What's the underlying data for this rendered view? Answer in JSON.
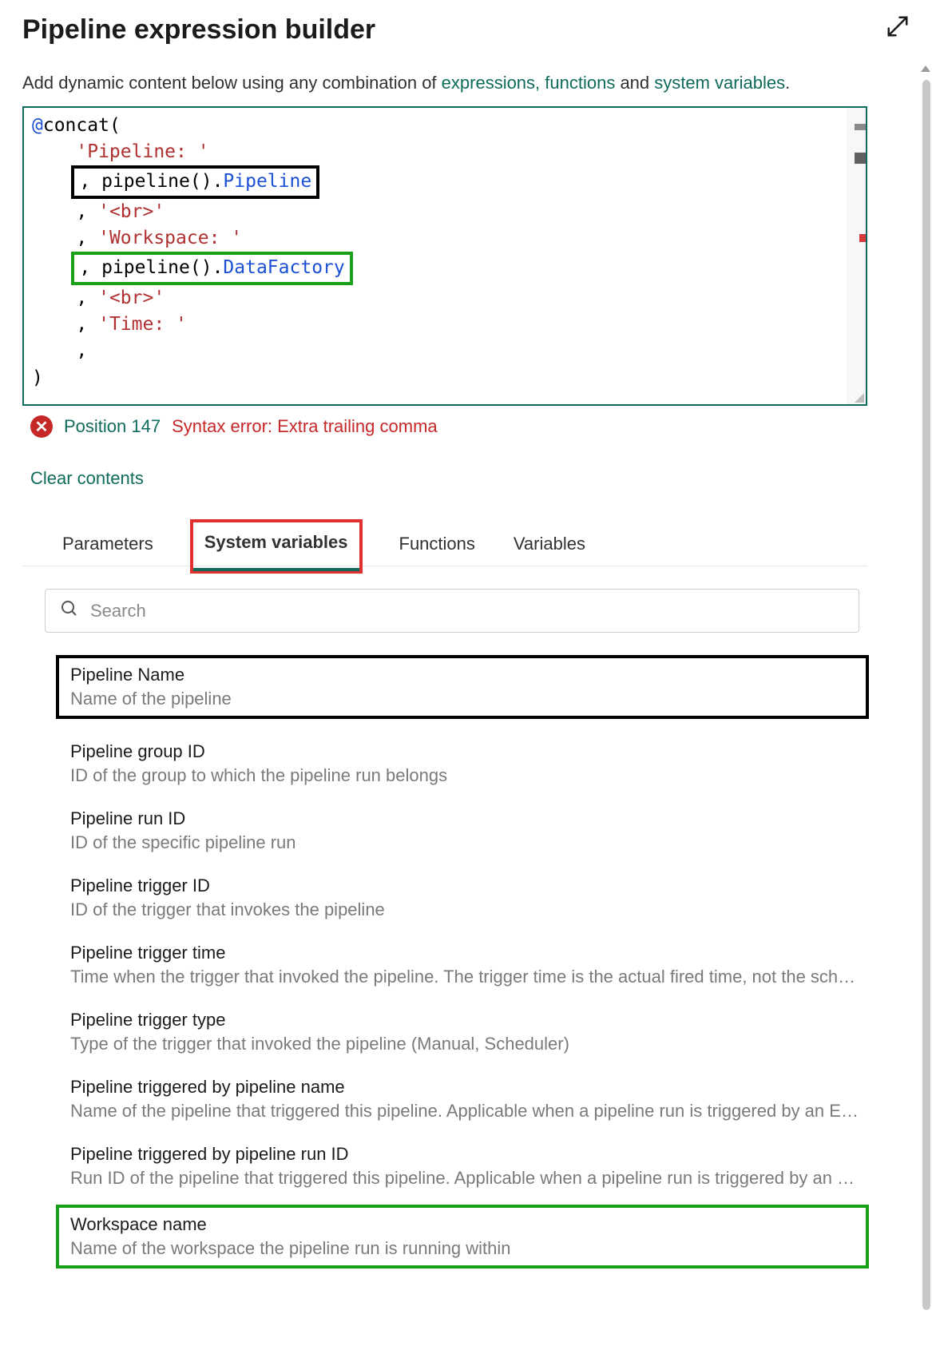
{
  "header": {
    "title": "Pipeline expression builder"
  },
  "intro": {
    "prefix": "Add dynamic content below using any combination of ",
    "link_expr_fn": "expressions, functions",
    "middle": " and ",
    "link_sysvars": "system variables",
    "suffix": "."
  },
  "editor": {
    "line1_at": "@",
    "line1_fn": "concat(",
    "line2_str": "'Pipeline: '",
    "line3_comma": ", ",
    "line3_call": "pipeline().",
    "line3_prop": "Pipeline",
    "line4_comma": ", ",
    "line4_str": "'<br>'",
    "line5_comma": ", ",
    "line5_str": "'Workspace: '",
    "line6_comma": ", ",
    "line6_call": "pipeline().",
    "line6_prop": "DataFactory",
    "line7_comma": ", ",
    "line7_str": "'<br>'",
    "line8_comma": ", ",
    "line8_str": "'Time: '",
    "line9_comma": ",",
    "line10_close": ")"
  },
  "error": {
    "position": "Position 147",
    "message": "Syntax error: Extra trailing comma"
  },
  "clear_contents": "Clear contents",
  "tabs": {
    "parameters": "Parameters",
    "system_variables": "System variables",
    "functions": "Functions",
    "variables": "Variables"
  },
  "search": {
    "placeholder": "Search"
  },
  "system_variables_list": [
    {
      "title": "Pipeline Name",
      "desc": "Name of the pipeline"
    },
    {
      "title": "Pipeline group ID",
      "desc": "ID of the group to which the pipeline run belongs"
    },
    {
      "title": "Pipeline run ID",
      "desc": "ID of the specific pipeline run"
    },
    {
      "title": "Pipeline trigger ID",
      "desc": "ID of the trigger that invokes the pipeline"
    },
    {
      "title": "Pipeline trigger time",
      "desc": "Time when the trigger that invoked the pipeline. The trigger time is the actual fired time, not the sch…"
    },
    {
      "title": "Pipeline trigger type",
      "desc": "Type of the trigger that invoked the pipeline (Manual, Scheduler)"
    },
    {
      "title": "Pipeline triggered by pipeline name",
      "desc": "Name of the pipeline that triggered this pipeline. Applicable when a pipeline run is triggered by an E…"
    },
    {
      "title": "Pipeline triggered by pipeline run ID",
      "desc": "Run ID of the pipeline that triggered this pipeline. Applicable when a pipeline run is triggered by an …"
    },
    {
      "title": "Workspace name",
      "desc": "Name of the workspace the pipeline run is running within"
    }
  ]
}
